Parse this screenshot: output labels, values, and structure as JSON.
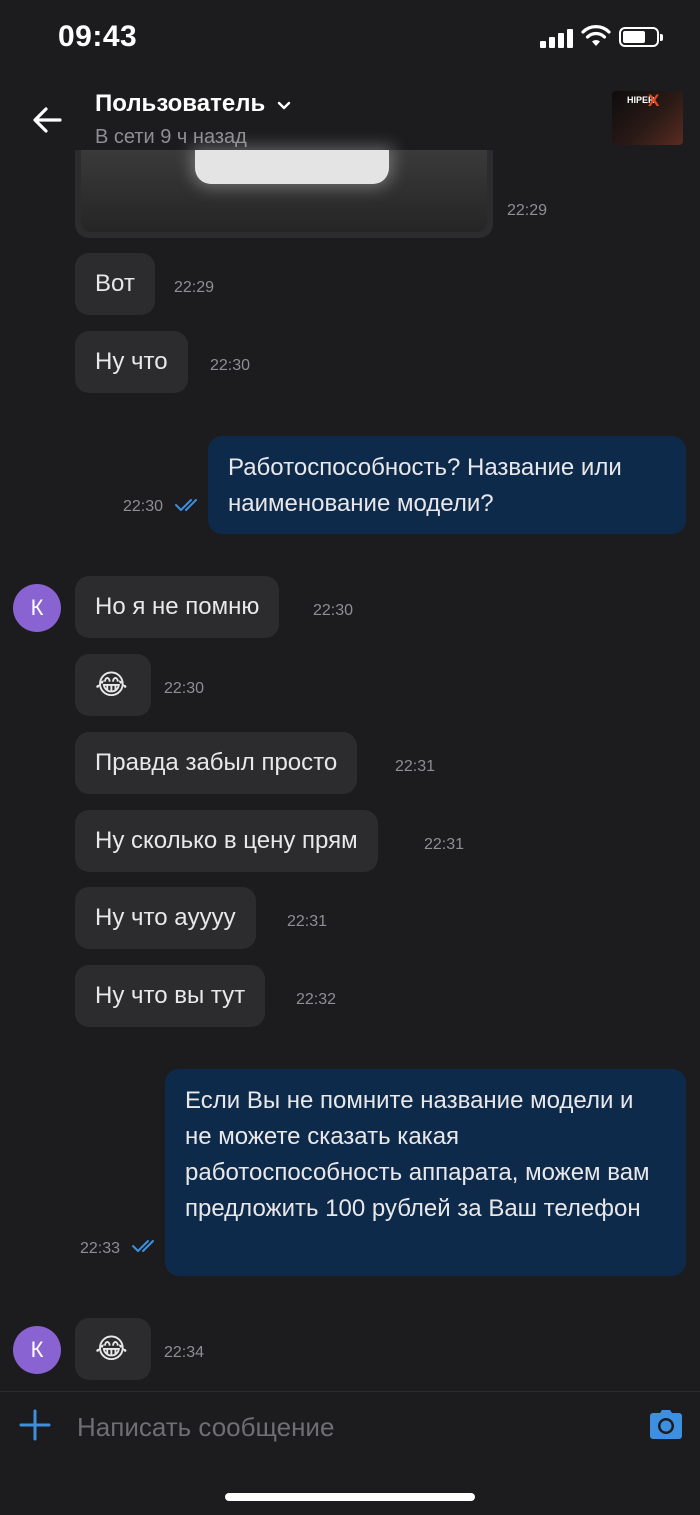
{
  "status_bar": {
    "time": "09:43"
  },
  "header": {
    "title": "Пользователь",
    "subtitle": "В сети 9 ч назад",
    "avatar_text_1": "HIPER",
    "avatar_text_2": "X"
  },
  "messages": [
    {
      "type": "photo",
      "time": "22:29"
    },
    {
      "type": "in",
      "text": "Вот",
      "time": "22:29"
    },
    {
      "type": "in",
      "text": "Ну что",
      "time": "22:30"
    },
    {
      "type": "out",
      "text": "Работоспособность? Название или наименование модели?",
      "time": "22:30",
      "read": true
    },
    {
      "type": "in",
      "text": "Но я не помню",
      "time": "22:30",
      "avatar": "К"
    },
    {
      "type": "in",
      "text": "😂",
      "time": "22:30"
    },
    {
      "type": "in",
      "text": "Правда забыл просто",
      "time": "22:31"
    },
    {
      "type": "in",
      "text": "Ну сколько в цену прям",
      "time": "22:31"
    },
    {
      "type": "in",
      "text": "Ну что аyyyy",
      "time": "22:31"
    },
    {
      "type": "in",
      "text": "Ну что вы тут",
      "time": "22:32"
    },
    {
      "type": "out",
      "text": "Если Вы не помните название модели и не можете сказать какая работоспособность аппарата, можем вам предложить 100 рублей за Ваш телефон",
      "time": "22:33",
      "read": true
    },
    {
      "type": "in",
      "text": "😂",
      "time": "22:34",
      "avatar": "К"
    }
  ],
  "composer": {
    "placeholder": "Написать сообщение"
  },
  "colors": {
    "accent": "#3d8fe0",
    "outgoing_bubble": "#0e2a4a",
    "incoming_bubble": "#2c2c2e",
    "avatar": "#8a63d2"
  }
}
